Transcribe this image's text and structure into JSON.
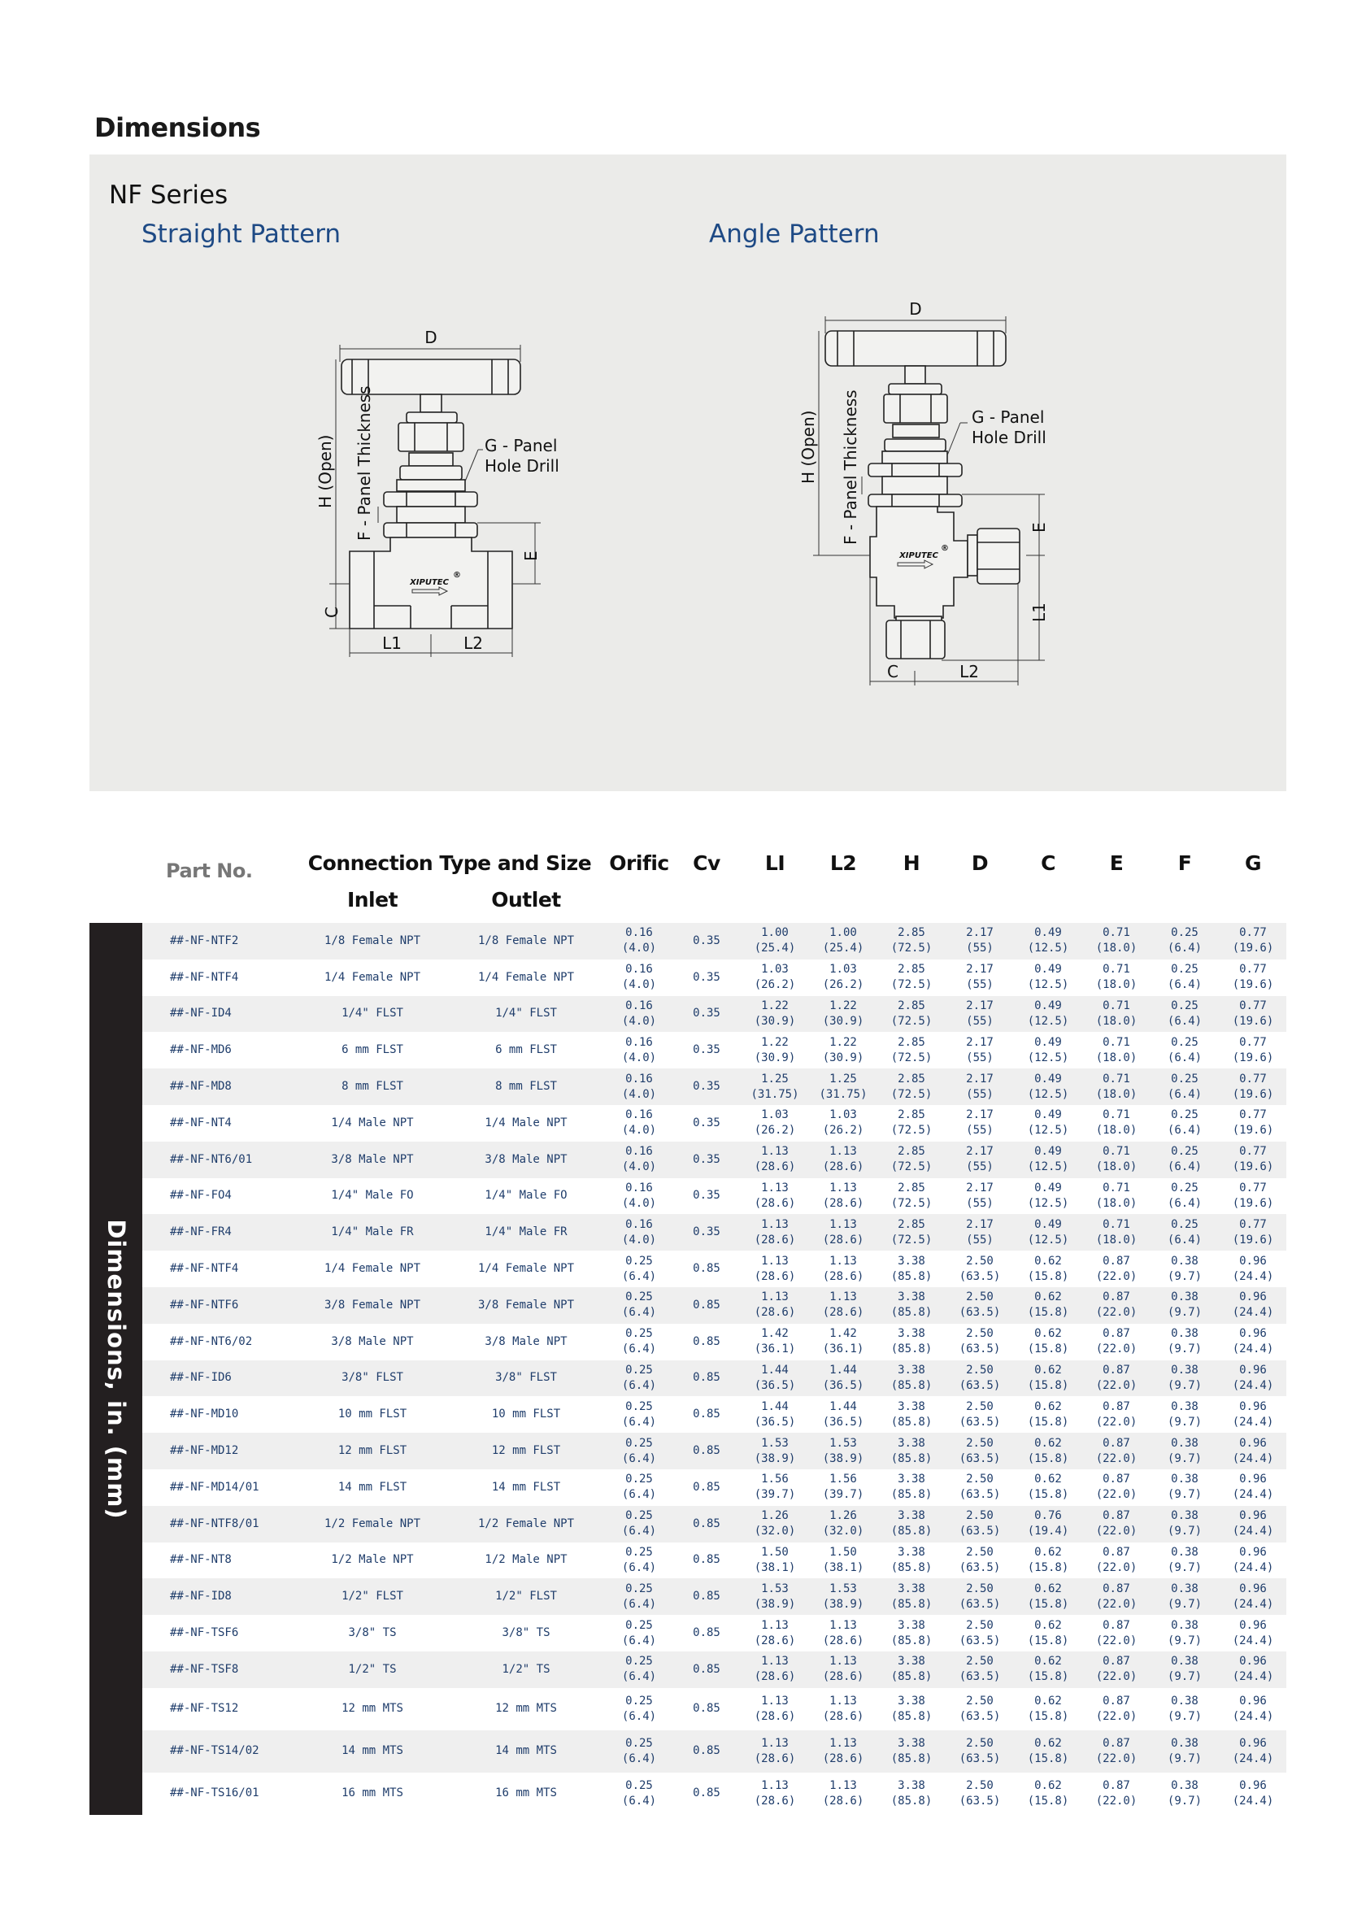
{
  "page": {
    "title": "Dimensions",
    "series": "NF Series",
    "straight_pattern": "Straight Pattern",
    "angle_pattern": "Angle Pattern"
  },
  "diagram_labels": {
    "d": "D",
    "h": "H (Open)",
    "f": "F - Panel Thickness",
    "g_line1": "G - Panel",
    "g_line2": "Hole Drill",
    "e": "E",
    "c": "C",
    "l1": "L1",
    "l2": "L2",
    "brand": "XIPUTEC",
    "reg": "®"
  },
  "table": {
    "side_label": "Dimensions, in. (mm)",
    "headers": {
      "part_no": "Part No.",
      "connection": "Connection Type and Size",
      "inlet": "Inlet",
      "outlet": "Outlet",
      "orific": "Orific",
      "cv": "Cv",
      "l1": "LI",
      "l2": "L2",
      "h": "H",
      "d": "D",
      "c": "C",
      "e": "E",
      "f": "F",
      "g": "G"
    },
    "rows": [
      [
        "##-NF-NTF2",
        "1/8 Female NPT",
        "1/8 Female NPT",
        [
          "0.16",
          "(4.0)"
        ],
        "0.35",
        [
          "1.00",
          "(25.4)"
        ],
        [
          "1.00",
          "(25.4)"
        ],
        [
          "2.85",
          "(72.5)"
        ],
        [
          "2.17",
          "(55)"
        ],
        [
          "0.49",
          "(12.5)"
        ],
        [
          "0.71",
          "(18.0)"
        ],
        [
          "0.25",
          "(6.4)"
        ],
        [
          "0.77",
          "(19.6)"
        ]
      ],
      [
        "##-NF-NTF4",
        "1/4 Female NPT",
        "1/4 Female NPT",
        [
          "0.16",
          "(4.0)"
        ],
        "0.35",
        [
          "1.03",
          "(26.2)"
        ],
        [
          "1.03",
          "(26.2)"
        ],
        [
          "2.85",
          "(72.5)"
        ],
        [
          "2.17",
          "(55)"
        ],
        [
          "0.49",
          "(12.5)"
        ],
        [
          "0.71",
          "(18.0)"
        ],
        [
          "0.25",
          "(6.4)"
        ],
        [
          "0.77",
          "(19.6)"
        ]
      ],
      [
        "##-NF-ID4",
        "1/4\" FLST",
        "1/4\" FLST",
        [
          "0.16",
          "(4.0)"
        ],
        "0.35",
        [
          "1.22",
          "(30.9)"
        ],
        [
          "1.22",
          "(30.9)"
        ],
        [
          "2.85",
          "(72.5)"
        ],
        [
          "2.17",
          "(55)"
        ],
        [
          "0.49",
          "(12.5)"
        ],
        [
          "0.71",
          "(18.0)"
        ],
        [
          "0.25",
          "(6.4)"
        ],
        [
          "0.77",
          "(19.6)"
        ]
      ],
      [
        "##-NF-MD6",
        "6 mm FLST",
        "6 mm FLST",
        [
          "0.16",
          "(4.0)"
        ],
        "0.35",
        [
          "1.22",
          "(30.9)"
        ],
        [
          "1.22",
          "(30.9)"
        ],
        [
          "2.85",
          "(72.5)"
        ],
        [
          "2.17",
          "(55)"
        ],
        [
          "0.49",
          "(12.5)"
        ],
        [
          "0.71",
          "(18.0)"
        ],
        [
          "0.25",
          "(6.4)"
        ],
        [
          "0.77",
          "(19.6)"
        ]
      ],
      [
        "##-NF-MD8",
        "8 mm FLST",
        "8 mm FLST",
        [
          "0.16",
          "(4.0)"
        ],
        "0.35",
        [
          "1.25",
          "(31.75)"
        ],
        [
          "1.25",
          "(31.75)"
        ],
        [
          "2.85",
          "(72.5)"
        ],
        [
          "2.17",
          "(55)"
        ],
        [
          "0.49",
          "(12.5)"
        ],
        [
          "0.71",
          "(18.0)"
        ],
        [
          "0.25",
          "(6.4)"
        ],
        [
          "0.77",
          "(19.6)"
        ]
      ],
      [
        "##-NF-NT4",
        "1/4 Male NPT",
        "1/4 Male NPT",
        [
          "0.16",
          "(4.0)"
        ],
        "0.35",
        [
          "1.03",
          "(26.2)"
        ],
        [
          "1.03",
          "(26.2)"
        ],
        [
          "2.85",
          "(72.5)"
        ],
        [
          "2.17",
          "(55)"
        ],
        [
          "0.49",
          "(12.5)"
        ],
        [
          "0.71",
          "(18.0)"
        ],
        [
          "0.25",
          "(6.4)"
        ],
        [
          "0.77",
          "(19.6)"
        ]
      ],
      [
        "##-NF-NT6/01",
        "3/8 Male NPT",
        "3/8 Male NPT",
        [
          "0.16",
          "(4.0)"
        ],
        "0.35",
        [
          "1.13",
          "(28.6)"
        ],
        [
          "1.13",
          "(28.6)"
        ],
        [
          "2.85",
          "(72.5)"
        ],
        [
          "2.17",
          "(55)"
        ],
        [
          "0.49",
          "(12.5)"
        ],
        [
          "0.71",
          "(18.0)"
        ],
        [
          "0.25",
          "(6.4)"
        ],
        [
          "0.77",
          "(19.6)"
        ]
      ],
      [
        "##-NF-FO4",
        "1/4\" Male FO",
        "1/4\" Male FO",
        [
          "0.16",
          "(4.0)"
        ],
        "0.35",
        [
          "1.13",
          "(28.6)"
        ],
        [
          "1.13",
          "(28.6)"
        ],
        [
          "2.85",
          "(72.5)"
        ],
        [
          "2.17",
          "(55)"
        ],
        [
          "0.49",
          "(12.5)"
        ],
        [
          "0.71",
          "(18.0)"
        ],
        [
          "0.25",
          "(6.4)"
        ],
        [
          "0.77",
          "(19.6)"
        ]
      ],
      [
        "##-NF-FR4",
        "1/4\" Male FR",
        "1/4\" Male FR",
        [
          "0.16",
          "(4.0)"
        ],
        "0.35",
        [
          "1.13",
          "(28.6)"
        ],
        [
          "1.13",
          "(28.6)"
        ],
        [
          "2.85",
          "(72.5)"
        ],
        [
          "2.17",
          "(55)"
        ],
        [
          "0.49",
          "(12.5)"
        ],
        [
          "0.71",
          "(18.0)"
        ],
        [
          "0.25",
          "(6.4)"
        ],
        [
          "0.77",
          "(19.6)"
        ]
      ],
      [
        "##-NF-NTF4",
        "1/4 Female NPT",
        "1/4 Female NPT",
        [
          "0.25",
          "(6.4)"
        ],
        "0.85",
        [
          "1.13",
          "(28.6)"
        ],
        [
          "1.13",
          "(28.6)"
        ],
        [
          "3.38",
          "(85.8)"
        ],
        [
          "2.50",
          "(63.5)"
        ],
        [
          "0.62",
          "(15.8)"
        ],
        [
          "0.87",
          "(22.0)"
        ],
        [
          "0.38",
          "(9.7)"
        ],
        [
          "0.96",
          "(24.4)"
        ]
      ],
      [
        "##-NF-NTF6",
        "3/8 Female NPT",
        "3/8 Female NPT",
        [
          "0.25",
          "(6.4)"
        ],
        "0.85",
        [
          "1.13",
          "(28.6)"
        ],
        [
          "1.13",
          "(28.6)"
        ],
        [
          "3.38",
          "(85.8)"
        ],
        [
          "2.50",
          "(63.5)"
        ],
        [
          "0.62",
          "(15.8)"
        ],
        [
          "0.87",
          "(22.0)"
        ],
        [
          "0.38",
          "(9.7)"
        ],
        [
          "0.96",
          "(24.4)"
        ]
      ],
      [
        "##-NF-NT6/02",
        "3/8 Male NPT",
        "3/8 Male NPT",
        [
          "0.25",
          "(6.4)"
        ],
        "0.85",
        [
          "1.42",
          "(36.1)"
        ],
        [
          "1.42",
          "(36.1)"
        ],
        [
          "3.38",
          "(85.8)"
        ],
        [
          "2.50",
          "(63.5)"
        ],
        [
          "0.62",
          "(15.8)"
        ],
        [
          "0.87",
          "(22.0)"
        ],
        [
          "0.38",
          "(9.7)"
        ],
        [
          "0.96",
          "(24.4)"
        ]
      ],
      [
        "##-NF-ID6",
        "3/8\" FLST",
        "3/8\" FLST",
        [
          "0.25",
          "(6.4)"
        ],
        "0.85",
        [
          "1.44",
          "(36.5)"
        ],
        [
          "1.44",
          "(36.5)"
        ],
        [
          "3.38",
          "(85.8)"
        ],
        [
          "2.50",
          "(63.5)"
        ],
        [
          "0.62",
          "(15.8)"
        ],
        [
          "0.87",
          "(22.0)"
        ],
        [
          "0.38",
          "(9.7)"
        ],
        [
          "0.96",
          "(24.4)"
        ]
      ],
      [
        "##-NF-MD10",
        "10 mm FLST",
        "10 mm FLST",
        [
          "0.25",
          "(6.4)"
        ],
        "0.85",
        [
          "1.44",
          "(36.5)"
        ],
        [
          "1.44",
          "(36.5)"
        ],
        [
          "3.38",
          "(85.8)"
        ],
        [
          "2.50",
          "(63.5)"
        ],
        [
          "0.62",
          "(15.8)"
        ],
        [
          "0.87",
          "(22.0)"
        ],
        [
          "0.38",
          "(9.7)"
        ],
        [
          "0.96",
          "(24.4)"
        ]
      ],
      [
        "##-NF-MD12",
        "12 mm FLST",
        "12 mm FLST",
        [
          "0.25",
          "(6.4)"
        ],
        "0.85",
        [
          "1.53",
          "(38.9)"
        ],
        [
          "1.53",
          "(38.9)"
        ],
        [
          "3.38",
          "(85.8)"
        ],
        [
          "2.50",
          "(63.5)"
        ],
        [
          "0.62",
          "(15.8)"
        ],
        [
          "0.87",
          "(22.0)"
        ],
        [
          "0.38",
          "(9.7)"
        ],
        [
          "0.96",
          "(24.4)"
        ]
      ],
      [
        "##-NF-MD14/01",
        "14 mm FLST",
        "14 mm FLST",
        [
          "0.25",
          "(6.4)"
        ],
        "0.85",
        [
          "1.56",
          "(39.7)"
        ],
        [
          "1.56",
          "(39.7)"
        ],
        [
          "3.38",
          "(85.8)"
        ],
        [
          "2.50",
          "(63.5)"
        ],
        [
          "0.62",
          "(15.8)"
        ],
        [
          "0.87",
          "(22.0)"
        ],
        [
          "0.38",
          "(9.7)"
        ],
        [
          "0.96",
          "(24.4)"
        ]
      ],
      [
        "##-NF-NTF8/01",
        "1/2 Female NPT",
        "1/2 Female NPT",
        [
          "0.25",
          "(6.4)"
        ],
        "0.85",
        [
          "1.26",
          "(32.0)"
        ],
        [
          "1.26",
          "(32.0)"
        ],
        [
          "3.38",
          "(85.8)"
        ],
        [
          "2.50",
          "(63.5)"
        ],
        [
          "0.76",
          "(19.4)"
        ],
        [
          "0.87",
          "(22.0)"
        ],
        [
          "0.38",
          "(9.7)"
        ],
        [
          "0.96",
          "(24.4)"
        ]
      ],
      [
        "##-NF-NT8",
        "1/2 Male NPT",
        "1/2 Male NPT",
        [
          "0.25",
          "(6.4)"
        ],
        "0.85",
        [
          "1.50",
          "(38.1)"
        ],
        [
          "1.50",
          "(38.1)"
        ],
        [
          "3.38",
          "(85.8)"
        ],
        [
          "2.50",
          "(63.5)"
        ],
        [
          "0.62",
          "(15.8)"
        ],
        [
          "0.87",
          "(22.0)"
        ],
        [
          "0.38",
          "(9.7)"
        ],
        [
          "0.96",
          "(24.4)"
        ]
      ],
      [
        "##-NF-ID8",
        "1/2\" FLST",
        "1/2\" FLST",
        [
          "0.25",
          "(6.4)"
        ],
        "0.85",
        [
          "1.53",
          "(38.9)"
        ],
        [
          "1.53",
          "(38.9)"
        ],
        [
          "3.38",
          "(85.8)"
        ],
        [
          "2.50",
          "(63.5)"
        ],
        [
          "0.62",
          "(15.8)"
        ],
        [
          "0.87",
          "(22.0)"
        ],
        [
          "0.38",
          "(9.7)"
        ],
        [
          "0.96",
          "(24.4)"
        ]
      ],
      [
        "##-NF-TSF6",
        "3/8\" TS",
        "3/8\" TS",
        [
          "0.25",
          "(6.4)"
        ],
        "0.85",
        [
          "1.13",
          "(28.6)"
        ],
        [
          "1.13",
          "(28.6)"
        ],
        [
          "3.38",
          "(85.8)"
        ],
        [
          "2.50",
          "(63.5)"
        ],
        [
          "0.62",
          "(15.8)"
        ],
        [
          "0.87",
          "(22.0)"
        ],
        [
          "0.38",
          "(9.7)"
        ],
        [
          "0.96",
          "(24.4)"
        ]
      ],
      [
        "##-NF-TSF8",
        "1/2\" TS",
        "1/2\" TS",
        [
          "0.25",
          "(6.4)"
        ],
        "0.85",
        [
          "1.13",
          "(28.6)"
        ],
        [
          "1.13",
          "(28.6)"
        ],
        [
          "3.38",
          "(85.8)"
        ],
        [
          "2.50",
          "(63.5)"
        ],
        [
          "0.62",
          "(15.8)"
        ],
        [
          "0.87",
          "(22.0)"
        ],
        [
          "0.38",
          "(9.7)"
        ],
        [
          "0.96",
          "(24.4)"
        ]
      ],
      [
        "##-NF-TS12",
        "12 mm MTS",
        "12 mm MTS",
        [
          "0.25",
          "(6.4)"
        ],
        "0.85",
        [
          "1.13",
          "(28.6)"
        ],
        [
          "1.13",
          "(28.6)"
        ],
        [
          "3.38",
          "(85.8)"
        ],
        [
          "2.50",
          "(63.5)"
        ],
        [
          "0.62",
          "(15.8)"
        ],
        [
          "0.87",
          "(22.0)"
        ],
        [
          "0.38",
          "(9.7)"
        ],
        [
          "0.96",
          "(24.4)"
        ]
      ],
      [
        "##-NF-TS14/02",
        "14 mm MTS",
        "14 mm MTS",
        [
          "0.25",
          "(6.4)"
        ],
        "0.85",
        [
          "1.13",
          "(28.6)"
        ],
        [
          "1.13",
          "(28.6)"
        ],
        [
          "3.38",
          "(85.8)"
        ],
        [
          "2.50",
          "(63.5)"
        ],
        [
          "0.62",
          "(15.8)"
        ],
        [
          "0.87",
          "(22.0)"
        ],
        [
          "0.38",
          "(9.7)"
        ],
        [
          "0.96",
          "(24.4)"
        ]
      ],
      [
        "##-NF-TS16/01",
        "16 mm MTS",
        "16 mm MTS",
        [
          "0.25",
          "(6.4)"
        ],
        "0.85",
        [
          "1.13",
          "(28.6)"
        ],
        [
          "1.13",
          "(28.6)"
        ],
        [
          "3.38",
          "(85.8)"
        ],
        [
          "2.50",
          "(63.5)"
        ],
        [
          "0.62",
          "(15.8)"
        ],
        [
          "0.87",
          "(22.0)"
        ],
        [
          "0.38",
          "(9.7)"
        ],
        [
          "0.96",
          "(24.4)"
        ]
      ]
    ]
  },
  "colors": {
    "accent_blue": "#1e4a85",
    "cell_text": "#1f3d6b",
    "panel_bg": "#ebebe9",
    "sidebar_bg": "#231f20"
  }
}
